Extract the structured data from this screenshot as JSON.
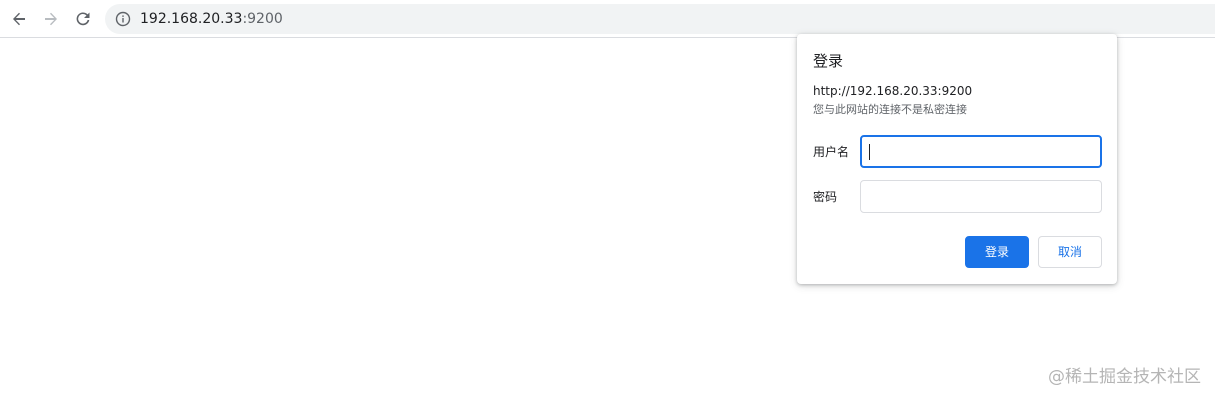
{
  "browser": {
    "url_host": "192.168.20.33",
    "url_port": ":9200",
    "icons": {
      "back": "arrow-left-icon",
      "forward": "arrow-right-icon",
      "reload": "reload-icon",
      "site_info": "info-icon"
    }
  },
  "dialog": {
    "title": "登录",
    "origin": "http://192.168.20.33:9200",
    "warning": "您与此网站的连接不是私密连接",
    "username_label": "用户名",
    "password_label": "密码",
    "username_value": "",
    "password_value": "",
    "login_label": "登录",
    "cancel_label": "取消"
  },
  "watermark": "@稀土掘金技术社区",
  "colors": {
    "accent": "#1a73e8",
    "omnibox_bg": "#f1f3f4",
    "muted_text": "#5f6368"
  }
}
